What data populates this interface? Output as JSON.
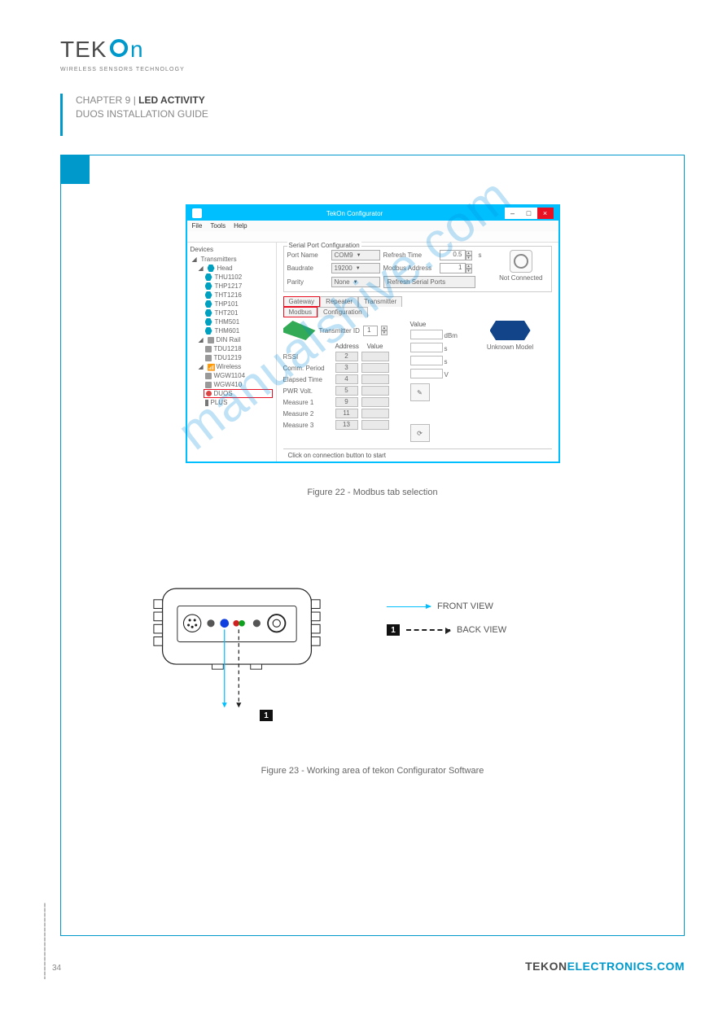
{
  "header": {
    "logo_text_1": "TEK",
    "logo_text_2": "ON",
    "tagline": "WIRELESS SENSORS TECHNOLOGY"
  },
  "chapter": {
    "line1": "CHAPTER 9",
    "label": "LED ACTIVITY",
    "doc_title": "DUOS INSTALLATION GUIDE"
  },
  "figure22_caption": "Figure 22 - Modbus tab selection",
  "figure23_caption": "Figure 23 - Working area of tekon Configurator Software",
  "legend": {
    "front": "FRONT VIEW",
    "back": "BACK VIEW"
  },
  "window": {
    "title": "TekOn Configurator",
    "minimize": "–",
    "maximize": "□",
    "close": "×",
    "menu": {
      "file": "File",
      "tools": "Tools",
      "help": "Help"
    }
  },
  "devices_panel": {
    "title": "Devices",
    "transmitters": "Transmitters",
    "head": "Head",
    "head_items": [
      "THU1102",
      "THP1217",
      "THT1216",
      "THP101",
      "THT201",
      "THM501",
      "THM601"
    ],
    "din_rail": "DIN Rail",
    "din_items": [
      "TDU1218",
      "TDU1219"
    ],
    "wireless": "Wireless",
    "wireless_items": [
      "WGW1104",
      "WGW410"
    ],
    "duos": "DUOS",
    "plus": "PLUS"
  },
  "serial": {
    "section_title": "Serial Port Configuration",
    "port_name_lbl": "Port Name",
    "port_name_val": "COM9",
    "refresh_time_lbl": "Refresh Time",
    "refresh_time_val": "0.5",
    "refresh_time_unit": "s",
    "baudrate_lbl": "Baudrate",
    "baudrate_val": "19200",
    "modbus_addr_lbl": "Modbus Address",
    "modbus_addr_val": "1",
    "parity_lbl": "Parity",
    "parity_val": "None",
    "refresh_btn": "Refresh Serial Ports",
    "not_connected": "Not Connected"
  },
  "tabs": {
    "gateway": "Gateway",
    "repeater": "Repeater",
    "transmitter": "Transmitter",
    "modbus": "Modbus",
    "configuration": "Configuration"
  },
  "modbus": {
    "transmitter_id_lbl": "Transmitter ID",
    "transmitter_id_val": "1",
    "address_hdr": "Address",
    "value_hdr": "Value",
    "value_hdr2": "Value",
    "rows": [
      {
        "label": "RSSI",
        "addr": "2",
        "unit": "dBm"
      },
      {
        "label": "Comm. Period",
        "addr": "3",
        "unit": "s"
      },
      {
        "label": "Elapsed Time",
        "addr": "4",
        "unit": "s"
      },
      {
        "label": "PWR Volt.",
        "addr": "5",
        "unit": "V"
      },
      {
        "label": "Measure 1",
        "addr": "9",
        "unit": ""
      },
      {
        "label": "Measure 2",
        "addr": "11",
        "unit": ""
      },
      {
        "label": "Measure 3",
        "addr": "13",
        "unit": ""
      }
    ],
    "unknown_model": "Unknown Model"
  },
  "status_bar": "Click on connection button to start",
  "marker": {
    "one": "1"
  },
  "footer": {
    "url1": "TEKON",
    "url2": "ELECTRONICS.COM",
    "page": "34"
  },
  "watermark": "manualshive.com"
}
